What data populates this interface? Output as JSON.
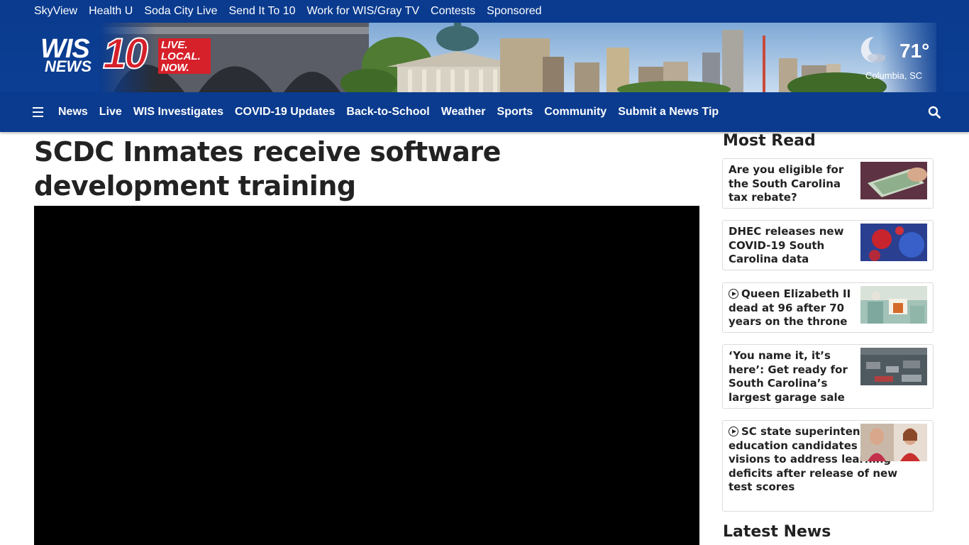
{
  "top_links": [
    "SkyView",
    "Health U",
    "Soda City Live",
    "Send It To 10",
    "Work for WIS/Gray TV",
    "Contests",
    "Sponsored"
  ],
  "logo": {
    "wis": "WIS",
    "news": "NEWS",
    "number": "10",
    "tagline_1": "LIVE.",
    "tagline_2": "LOCAL.",
    "tagline_3": "NOW."
  },
  "weather": {
    "temp": "71°",
    "city": "Columbia, SC",
    "icon": "moon-cloud-icon"
  },
  "nav": [
    "News",
    "Live",
    "WIS Investigates",
    "COVID-19 Updates",
    "Back-to-School",
    "Weather",
    "Sports",
    "Community",
    "Submit a News Tip"
  ],
  "article": {
    "headline": "SCDC Inmates receive software development training"
  },
  "most_read": {
    "title": "Most Read",
    "items": [
      {
        "text": "Are you eligible for the South Carolina tax rebate?",
        "video": false
      },
      {
        "text": "DHEC releases new COVID-19 South Carolina data",
        "video": false
      },
      {
        "text": "Queen Elizabeth II dead at 96 after 70 years on the throne",
        "video": true
      },
      {
        "text": "‘You name it, it’s here’: Get ready for South Carolina’s largest garage sale",
        "video": false
      },
      {
        "text": "SC state superintendent of education candidates outline visions to address learning deficits after release of new test scores",
        "video": true
      }
    ]
  },
  "latest_news": {
    "title": "Latest News"
  },
  "colors": {
    "brand_blue": "#0a3b8f",
    "brand_red": "#d6202a"
  }
}
